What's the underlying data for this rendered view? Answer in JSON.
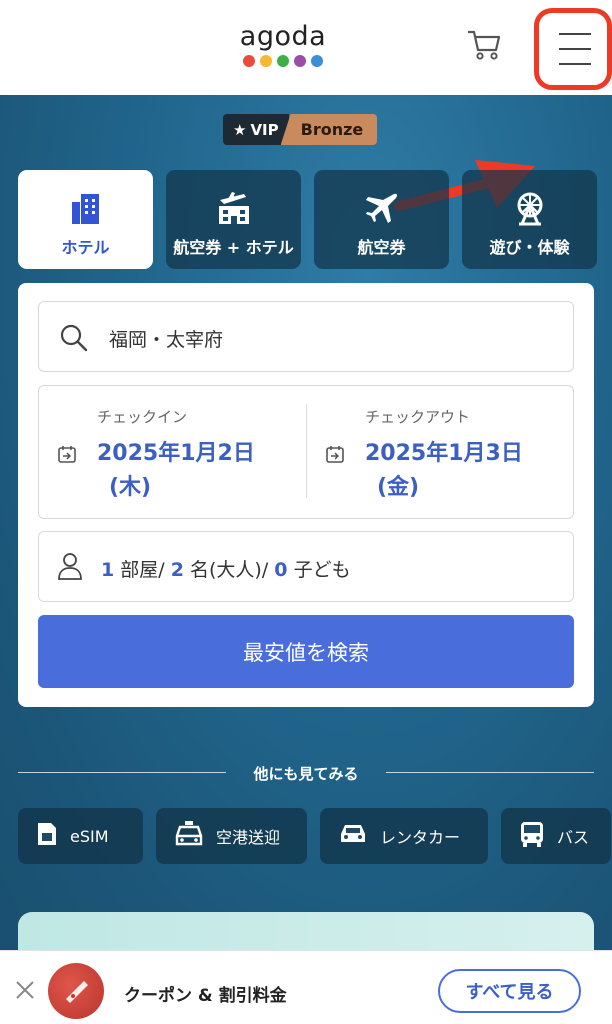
{
  "header": {
    "logo_text": "agoda",
    "logo_dot_colors": [
      "#e94b3c",
      "#f5b82e",
      "#3fae49",
      "#9b4ea8",
      "#3a8fd6"
    ],
    "cart_icon": "cart-icon",
    "menu_icon": "hamburger-menu-icon",
    "highlight_color": "#ee3a24"
  },
  "vip": {
    "label": "VIP",
    "tier": "Bronze"
  },
  "tabs": [
    {
      "label": "ホテル",
      "icon": "hotel-icon",
      "active": true
    },
    {
      "label": "航空券 + ホテル",
      "icon": "flight-hotel-icon",
      "active": false
    },
    {
      "label": "航空券",
      "icon": "airplane-icon",
      "active": false
    },
    {
      "label": "遊び・体験",
      "icon": "ferris-wheel-icon",
      "active": false
    }
  ],
  "search": {
    "destination": "福岡・太宰府"
  },
  "dates": {
    "checkin_label": "チェックイン",
    "checkin_date": "2025年1月2日",
    "checkin_day": "(木)",
    "checkout_label": "チェックアウト",
    "checkout_date": "2025年1月3日",
    "checkout_day": "(金)"
  },
  "guests": {
    "rooms": "1",
    "rooms_label": "部屋/",
    "adults": "2",
    "adults_label": "名(大人)/",
    "children": "0",
    "children_label": "子ども"
  },
  "search_button": "最安値を検索",
  "explore": {
    "title": "他にも見てみる",
    "chips": [
      {
        "label": "eSIM",
        "icon": "sim-card-icon"
      },
      {
        "label": "空港送迎",
        "icon": "taxi-icon"
      },
      {
        "label": "レンタカー",
        "icon": "car-icon"
      },
      {
        "label": "バス",
        "icon": "bus-icon"
      }
    ]
  },
  "bottom_bar": {
    "coupon_text": "クーポン & 割引料金",
    "see_all": "すべて見る"
  },
  "colors": {
    "accent_blue": "#4a6ddc",
    "text_blue": "#3b5fc4",
    "bronze": "#c98a5d"
  }
}
